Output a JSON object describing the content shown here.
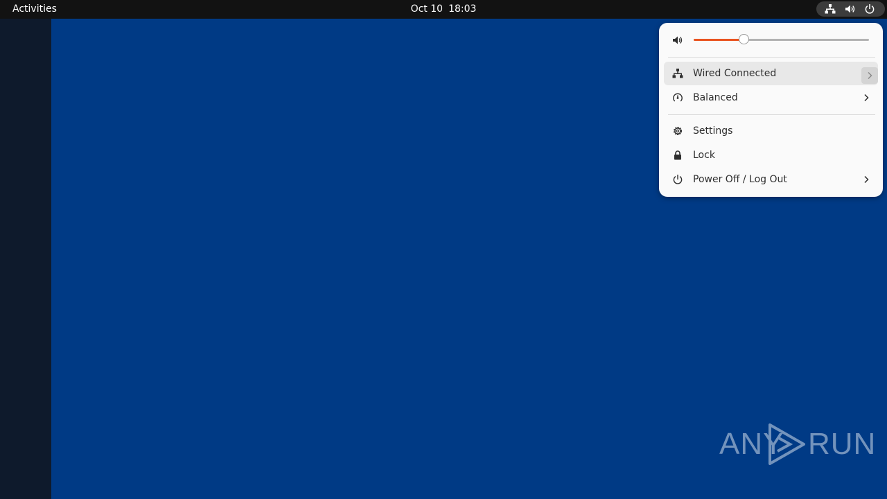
{
  "topbar": {
    "activities_label": "Activities",
    "date": "Oct 10",
    "time": "18:03",
    "tray_icons": [
      "network-wired-icon",
      "volume-icon",
      "power-icon"
    ]
  },
  "menu": {
    "volume": {
      "icon": "volume-icon",
      "level_percent": 29
    },
    "items": [
      {
        "label": "Wired Connected",
        "icon": "network-wired-icon",
        "has_submenu": true
      },
      {
        "label": "Balanced",
        "icon": "power-profile-icon",
        "has_submenu": true
      },
      {
        "label": "Settings",
        "icon": "gear-icon",
        "has_submenu": false
      },
      {
        "label": "Lock",
        "icon": "lock-icon",
        "has_submenu": false
      },
      {
        "label": "Power Off / Log Out",
        "icon": "power-icon",
        "has_submenu": true
      }
    ]
  },
  "watermark": {
    "text_left": "ANY",
    "text_right": "RUN"
  },
  "colors": {
    "desktop": "#003a85",
    "topbar": "#121212",
    "dock": "#0e1a2c",
    "accent": "#e95420",
    "menu_bg": "#fafafa"
  }
}
